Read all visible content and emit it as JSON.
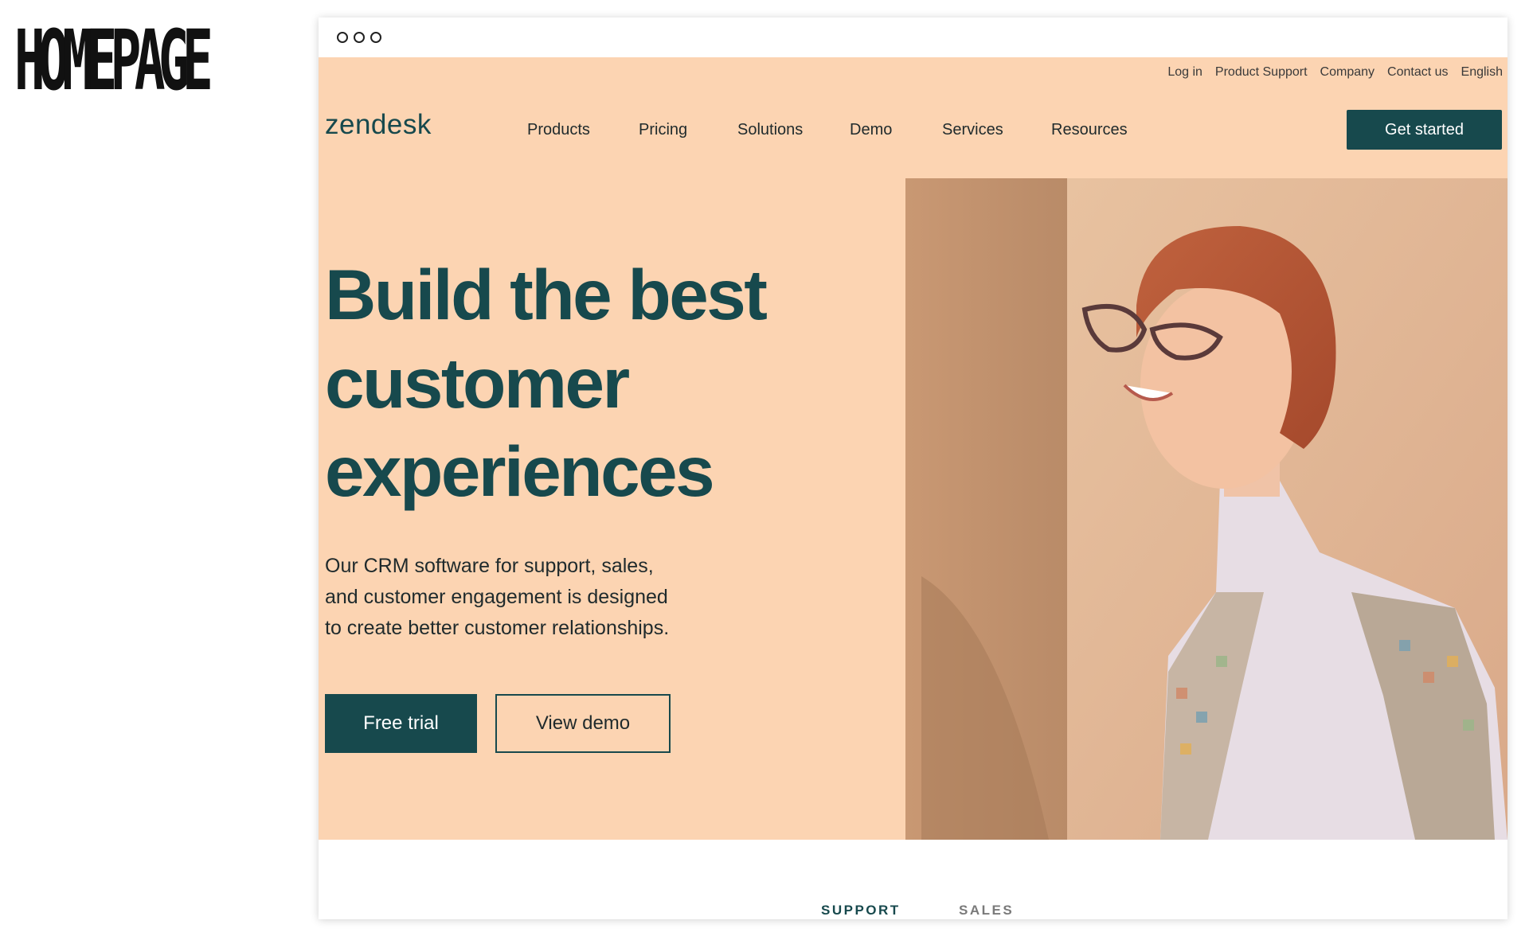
{
  "slide": {
    "title": "HOMEPAGE"
  },
  "utility_nav": {
    "items": [
      "Log in",
      "Product Support",
      "Company",
      "Contact us",
      "English"
    ]
  },
  "brand": {
    "logo": "zendesk"
  },
  "main_nav": {
    "items": [
      "Products",
      "Pricing",
      "Solutions",
      "Demo",
      "Services",
      "Resources"
    ],
    "cta": "Get started"
  },
  "hero": {
    "headline": [
      "Build the best",
      "customer",
      "experiences"
    ],
    "subtext": [
      "Our CRM software for support, sales,",
      "and customer engagement is designed",
      "to create better customer relationships."
    ],
    "primary_button": "Free trial",
    "secondary_button": "View demo"
  },
  "tabs": [
    "SUPPORT",
    "SALES"
  ],
  "colors": {
    "hero_bg": "#fcd4b2",
    "brand_dark": "#17494d"
  }
}
